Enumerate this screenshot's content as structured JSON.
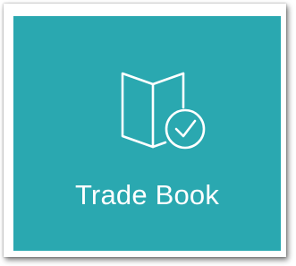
{
  "tile": {
    "label": "Trade Book",
    "icon": "open-book-check-icon",
    "background_color": "#2aa8b0",
    "foreground_color": "#ffffff"
  }
}
